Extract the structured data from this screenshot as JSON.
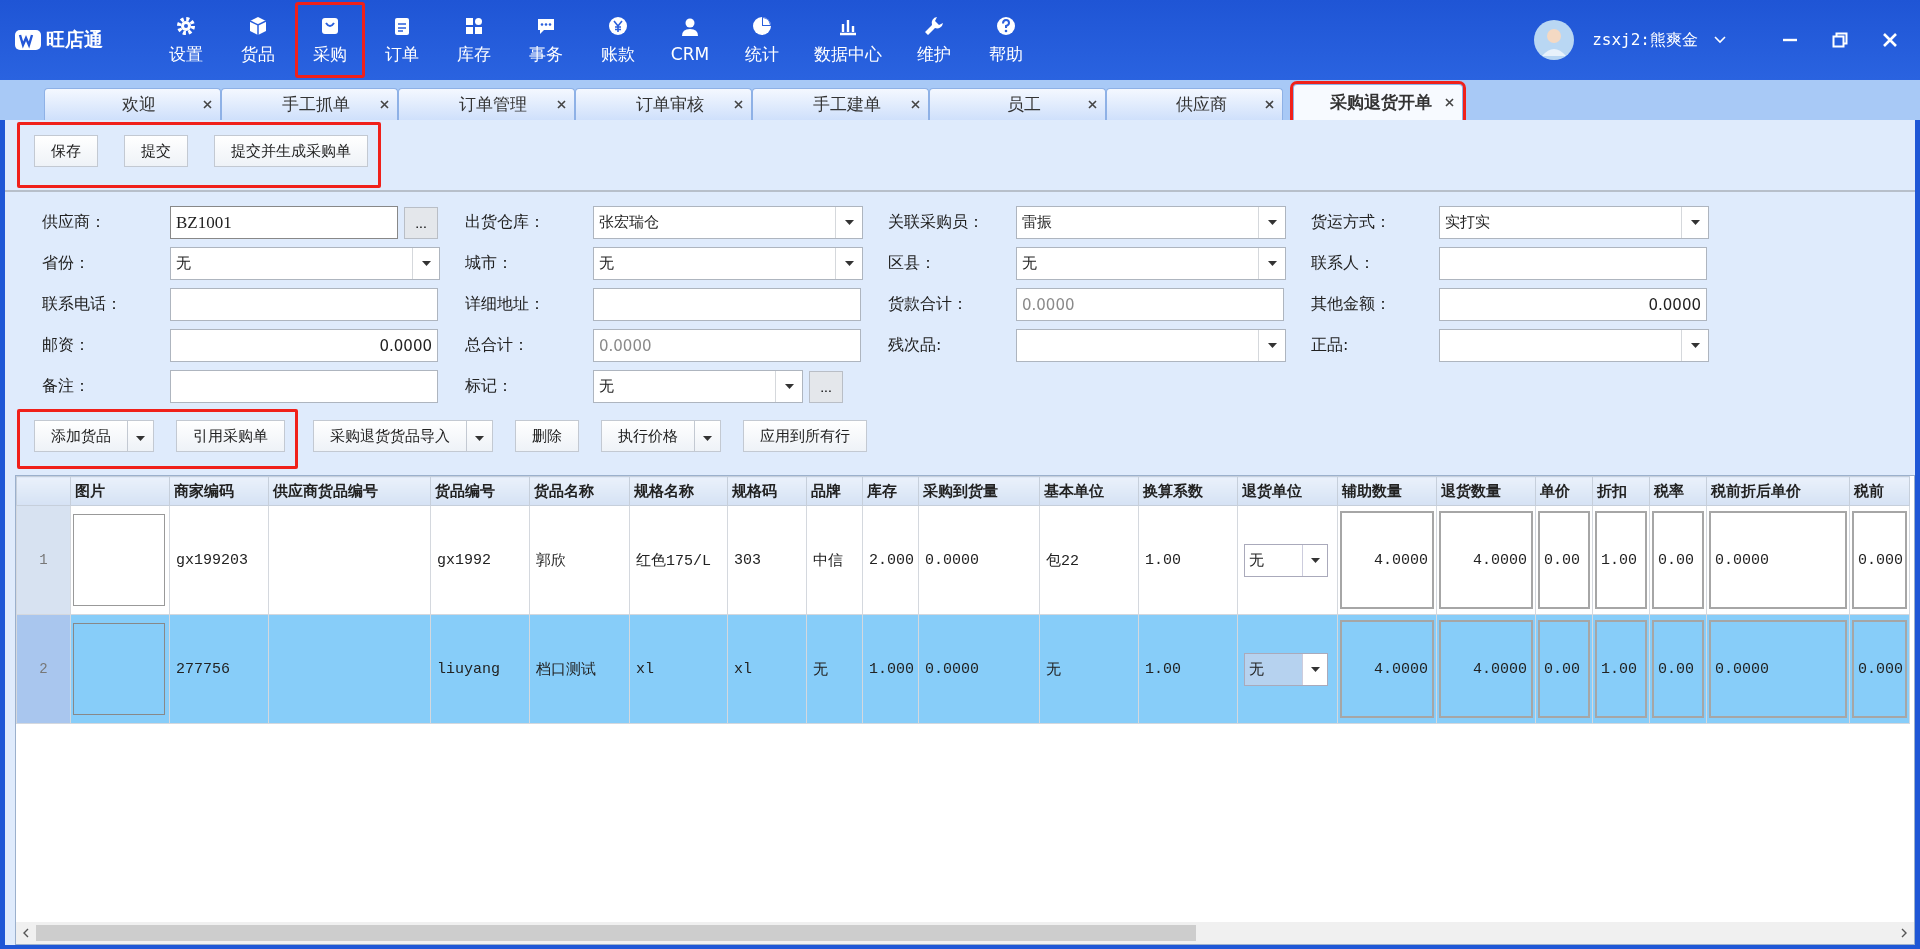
{
  "app": {
    "logo": "旺店通",
    "user": {
      "name": "zsxj2:熊爽金"
    },
    "nav": [
      {
        "label": "设置",
        "selected": false
      },
      {
        "label": "货品",
        "selected": false
      },
      {
        "label": "采购",
        "selected": true
      },
      {
        "label": "订单",
        "selected": false
      },
      {
        "label": "库存",
        "selected": false
      },
      {
        "label": "事务",
        "selected": false
      },
      {
        "label": "账款",
        "selected": false
      },
      {
        "label": "CRM",
        "selected": false
      },
      {
        "label": "统计",
        "selected": false
      },
      {
        "label": "数据中心",
        "selected": false
      },
      {
        "label": "维护",
        "selected": false
      },
      {
        "label": "帮助",
        "selected": false
      }
    ]
  },
  "tabs": [
    {
      "label": "欢迎",
      "selected": false
    },
    {
      "label": "手工抓单",
      "selected": false
    },
    {
      "label": "订单管理",
      "selected": false
    },
    {
      "label": "订单审核",
      "selected": false
    },
    {
      "label": "手工建单",
      "selected": false
    },
    {
      "label": "员工",
      "selected": false
    },
    {
      "label": "供应商",
      "selected": false
    },
    {
      "label": "采购退货开单",
      "selected": true
    }
  ],
  "toolbar": {
    "groups": [
      {
        "highlighted": true,
        "buttons": [
          {
            "label": "保存"
          },
          {
            "label": "提交"
          },
          {
            "label": "提交并生成采购单"
          }
        ]
      }
    ]
  },
  "form": {
    "rows": [
      [
        {
          "label": "供应商：",
          "kind": "lookup",
          "value": "BZ1001",
          "more": "..."
        },
        {
          "label": "出货仓库：",
          "kind": "select",
          "value": "张宏瑞仓"
        },
        {
          "label": "关联采购员：",
          "kind": "select",
          "value": "雷振"
        },
        {
          "label": "货运方式：",
          "kind": "select",
          "value": "实打实"
        }
      ],
      [
        {
          "label": "省份：",
          "kind": "select",
          "value": "无"
        },
        {
          "label": "城市：",
          "kind": "select",
          "value": "无"
        },
        {
          "label": "区县：",
          "kind": "select",
          "value": "无"
        },
        {
          "label": "联系人：",
          "kind": "text"
        }
      ],
      [
        {
          "label": "联系电话：",
          "kind": "text"
        },
        {
          "label": "详细地址：",
          "kind": "text"
        },
        {
          "label": "货款合计：",
          "kind": "disabled",
          "value": "0.0000"
        },
        {
          "label": "其他金额：",
          "kind": "number",
          "value": "0.0000"
        }
      ],
      [
        {
          "label": "邮资：",
          "kind": "number",
          "value": "0.0000"
        },
        {
          "label": "总合计：",
          "kind": "disabled",
          "value": "0.0000"
        },
        {
          "label": "残次品:",
          "kind": "select"
        },
        {
          "label": "正品:",
          "kind": "select"
        }
      ],
      [
        {
          "label": "备注：",
          "kind": "text"
        },
        {
          "label": "标记：",
          "kind": "select_more",
          "value": "无",
          "more": "..."
        }
      ]
    ]
  },
  "item_toolbar": {
    "groups": [
      {
        "highlighted": true,
        "buttons": [
          {
            "label": "添加货品",
            "has_menu": true
          },
          {
            "label": "引用采购单",
            "has_menu": false
          }
        ]
      },
      {
        "highlighted": false,
        "buttons": [
          {
            "label": "采购退货货品导入",
            "has_menu": true
          },
          {
            "label": "删除",
            "has_menu": false
          },
          {
            "label": "执行价格",
            "has_menu": true
          },
          {
            "label": "应用到所有行",
            "has_menu": false
          }
        ]
      }
    ]
  },
  "table": {
    "columns": [
      "图片",
      "商家编码",
      "供应商货品编号",
      "货品编号",
      "货品名称",
      "规格名称",
      "规格码",
      "品牌",
      "库存",
      "采购到货量",
      "基本单位",
      "换算系数",
      "退货单位",
      "辅助数量",
      "退货数量",
      "单价",
      "折扣",
      "税率",
      "税前折后单价",
      "税前"
    ],
    "rows": [
      {
        "number": "1",
        "selected": false,
        "cells": [
          {
            "kind": "image"
          },
          {
            "kind": "text",
            "value": "gx199203"
          },
          {
            "kind": "text"
          },
          {
            "kind": "text",
            "value": "gx1992"
          },
          {
            "kind": "text",
            "value": "郭欣"
          },
          {
            "kind": "text",
            "value": "红色175/L"
          },
          {
            "kind": "text",
            "value": "303"
          },
          {
            "kind": "text",
            "value": "中信"
          },
          {
            "kind": "text",
            "value": "2.000"
          },
          {
            "kind": "text",
            "value": "0.0000"
          },
          {
            "kind": "text",
            "value": "包22"
          },
          {
            "kind": "text",
            "value": "1.00"
          },
          {
            "kind": "select",
            "value": "无"
          },
          {
            "kind": "input",
            "value": "4.0000"
          },
          {
            "kind": "input",
            "value": "4.0000"
          },
          {
            "kind": "input",
            "value": "0.00"
          },
          {
            "kind": "input",
            "value": "1.00"
          },
          {
            "kind": "input",
            "value": "0.00"
          },
          {
            "kind": "input",
            "value": "0.0000"
          },
          {
            "kind": "input",
            "value": "0.000"
          }
        ]
      },
      {
        "number": "2",
        "selected": true,
        "cells": [
          {
            "kind": "image"
          },
          {
            "kind": "text",
            "value": "277756"
          },
          {
            "kind": "text"
          },
          {
            "kind": "text",
            "value": "liuyang"
          },
          {
            "kind": "text",
            "value": "档口测试"
          },
          {
            "kind": "text",
            "value": "xl"
          },
          {
            "kind": "text",
            "value": "xl"
          },
          {
            "kind": "text",
            "value": "无"
          },
          {
            "kind": "text",
            "value": "1.000"
          },
          {
            "kind": "text",
            "value": "0.0000"
          },
          {
            "kind": "text",
            "value": "无"
          },
          {
            "kind": "text",
            "value": "1.00"
          },
          {
            "kind": "select",
            "value": "无"
          },
          {
            "kind": "input",
            "value": "4.0000"
          },
          {
            "kind": "input",
            "value": "4.0000"
          },
          {
            "kind": "input",
            "value": "0.00"
          },
          {
            "kind": "input",
            "value": "1.00"
          },
          {
            "kind": "input",
            "value": "0.00"
          },
          {
            "kind": "input",
            "value": "0.0000"
          },
          {
            "kind": "input",
            "value": "0.000"
          }
        ]
      }
    ]
  }
}
